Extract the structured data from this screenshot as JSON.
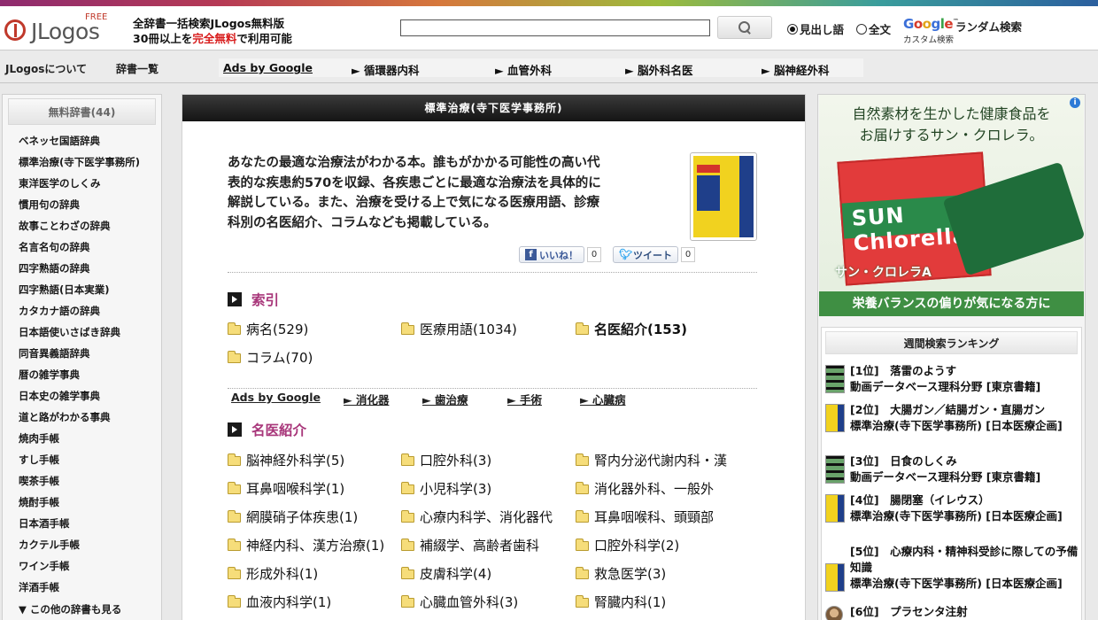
{
  "colors": {
    "accent": "#a8367a",
    "free_red": "#d81b1b",
    "title_bar": "#1a1a1a",
    "ad_green": "#3f8f43"
  },
  "header": {
    "logo": "JLogos",
    "logo_badge": "FREE",
    "tagline_1": "全辞書一括検索JLogos無料版",
    "tagline_2_a": "30冊以上を",
    "tagline_2_b": "完全無料",
    "tagline_2_c": "で利用可能",
    "search_value": "",
    "search_icon": "search-icon",
    "radio_headword": "見出し語",
    "radio_fulltext": "全文",
    "google_word": "Google",
    "google_sub": "カスタム検索",
    "random": "ランダム検索"
  },
  "nav": {
    "about": "JLogosについて",
    "dict_list": "辞書一覧",
    "ads_label": "Ads by Google",
    "ad_links": [
      "► 循環器内科",
      "► 血管外科",
      "► 脳外科名医",
      "► 脳神経外科"
    ]
  },
  "sidebar": {
    "heading": "無料辞書(44)",
    "items": [
      "ベネッセ国語辞典",
      "標準治療(寺下医学事務所)",
      "東洋医学のしくみ",
      "慣用句の辞典",
      "故事ことわざの辞典",
      "名言名句の辞典",
      "四字熟語の辞典",
      "四字熟語(日本実業)",
      "カタカナ語の辞典",
      "日本語使いさばき辞典",
      "同音異義語辞典",
      "暦の雑学事典",
      "日本史の雑学事典",
      "道と路がわかる事典",
      "焼肉手帳",
      "すし手帳",
      "喫茶手帳",
      "焼酎手帳",
      "日本酒手帳",
      "カクテル手帳",
      "ワイン手帳",
      "洋酒手帳"
    ],
    "more": "▼ この他の辞書も見る"
  },
  "main": {
    "title": "標準治療(寺下医学事務所)",
    "desc_lines": [
      "あなたの最適な治療法がわかる本。誰もがかかる可能性の高い代",
      "表的な疾患約570を収録、各疾患ごとに最適な治療法を具体的に",
      "解説している。また、治療を受ける上で気になる医療用語、診療",
      "科別の名医紹介、コラムなども掲載している。"
    ],
    "like_label": "いいね！",
    "like_count": "0",
    "tweet_label": "ツイート",
    "tweet_count": "0",
    "index_heading": "索引",
    "index_items": [
      "病名(529)",
      "医療用語(1034)",
      "名医紹介(153)",
      "コラム(70)"
    ],
    "ads_label": "Ads by Google",
    "ad_links": [
      "► 消化器",
      "► 歯治療",
      "► 手術",
      "► 心臓病"
    ],
    "doctors_heading": "名医紹介",
    "doctor_items": [
      "脳神経外科学(5)",
      "口腔外科(3)",
      "腎内分泌代謝内科・漢",
      "耳鼻咽喉科学(1)",
      "小児科学(3)",
      "消化器外科、一般外",
      "網膜硝子体疾患(1)",
      "心療内科学、消化器代",
      "耳鼻咽喉科、頭頸部",
      "神経内科、漢方治療(1)",
      "補綴学、高齢者歯科",
      "口腔外科学(2)",
      "形成外科(1)",
      "皮膚科学(4)",
      "救急医学(3)",
      "血液内科学(1)",
      "心臓血管外科(3)",
      "腎臓内科(1)"
    ]
  },
  "right": {
    "ad_line_1": "自然素材を生かした健康食品を",
    "ad_line_2": "お届けするサン・クロレラ。",
    "ad_brand": "SUN Chlorella",
    "ad_name": "サン・クロレラA",
    "ad_bar": "栄養バランスの偏りが気になる方に",
    "ranking_heading": "週間検索ランキング",
    "ranking": [
      {
        "rank": "[1位]",
        "title": "落雷のようす",
        "source": "動画データベース理科分野 [東京書籍]",
        "thumb": "film-icon"
      },
      {
        "rank": "[2位]",
        "title": "大腸ガン／結腸ガン・直腸ガン",
        "source": "標準治療(寺下医学事務所) [日本医療企画]",
        "thumb": "book-icon"
      },
      {
        "rank": "[3位]",
        "title": "日食のしくみ",
        "source": "動画データベース理科分野 [東京書籍]",
        "thumb": "film-icon"
      },
      {
        "rank": "[4位]",
        "title": "腸閉塞（イレウス）",
        "source": "標準治療(寺下医学事務所) [日本医療企画]",
        "thumb": "book-icon"
      },
      {
        "rank": "[5位]",
        "title": "心療内科・精神科受診に際しての予備知識",
        "source": "標準治療(寺下医学事務所) [日本医療企画]",
        "thumb": "book-icon"
      },
      {
        "rank": "[6位]",
        "title": "プラセンタ注射",
        "source": "",
        "thumb": "photo-icon"
      }
    ]
  }
}
